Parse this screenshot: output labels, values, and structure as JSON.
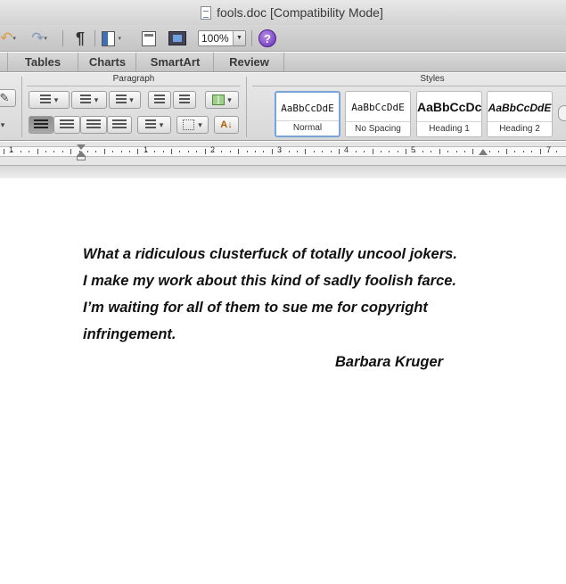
{
  "window": {
    "title": "fools.doc [Compatibility Mode]"
  },
  "toolbar": {
    "zoom": "100%",
    "help_glyph": "?",
    "pilcrow_glyph": "¶"
  },
  "ribbon": {
    "tabs": [
      "Tables",
      "Charts",
      "SmartArt",
      "Review"
    ],
    "groups": {
      "paragraph": "Paragraph",
      "styles": "Styles"
    },
    "styles": [
      {
        "sample": "AaBbCcDdE",
        "name": "Normal",
        "selected": true
      },
      {
        "sample": "AaBbCcDdE",
        "name": "No Spacing",
        "selected": false
      },
      {
        "sample": "AaBbCcDc",
        "name": "Heading 1",
        "selected": false
      },
      {
        "sample": "AaBbCcDdE",
        "name": "Heading 2",
        "selected": false
      }
    ]
  },
  "ruler": {
    "numbers": [
      "1",
      "1",
      "2",
      "3",
      "4",
      "5",
      "7"
    ]
  },
  "document": {
    "lines": [
      "What a ridiculous clusterfuck of totally uncool jokers.",
      "I make my work about this kind of sadly foolish farce.",
      "I’m waiting for all of them to sue me for copyright",
      "infringement."
    ],
    "author": "Barbara Kruger"
  }
}
